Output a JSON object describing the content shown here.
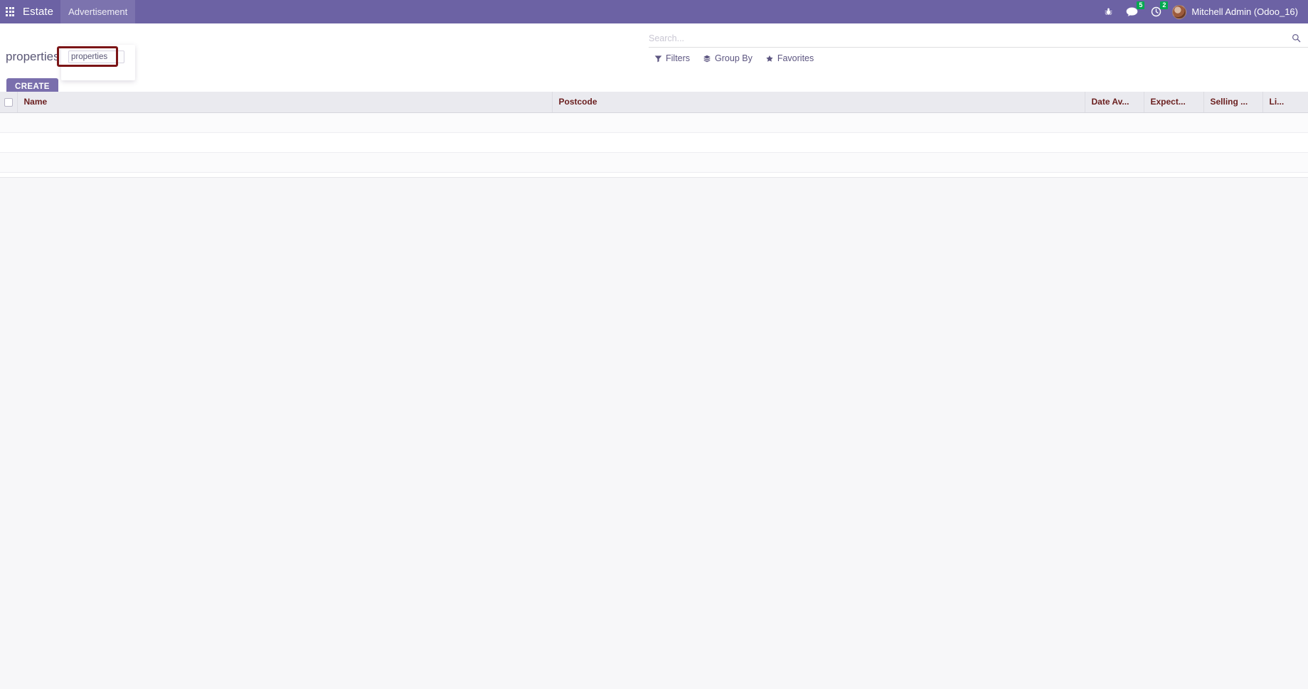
{
  "navbar": {
    "apps_icon": "apps-grid-icon",
    "brand": "Estate",
    "menus": [
      {
        "label": "Advertisement",
        "active": true
      }
    ],
    "systray": {
      "debug_icon": "bug-icon",
      "messages_icon": "chat-bubble-icon",
      "messages_count": "5",
      "activities_icon": "clock-icon",
      "activities_count": "2",
      "avatar_icon": "user-avatar",
      "user_name": "Mitchell Admin (Odoo_16)"
    }
  },
  "control_panel": {
    "breadcrumb": "properties",
    "create_label": "CREATE",
    "rename_input_value": "properties",
    "rename_input_placeholder": "properties",
    "annotation_color": "#7b1416"
  },
  "search": {
    "value": "",
    "placeholder": "Search...",
    "search_icon": "magnifier-icon",
    "facets": [
      {
        "label": "Filters",
        "icon": "funnel-icon"
      },
      {
        "label": "Group By",
        "icon": "layers-icon"
      },
      {
        "label": "Favorites",
        "icon": "star-icon"
      }
    ]
  },
  "list": {
    "select_all_icon": "checkbox-unchecked",
    "columns": [
      {
        "label": "Name"
      },
      {
        "label": "Postcode"
      },
      {
        "label": "Date Av..."
      },
      {
        "label": "Expect..."
      },
      {
        "label": "Selling ..."
      },
      {
        "label": "Li..."
      }
    ],
    "rows": [],
    "empty_row_count": 3
  },
  "colors": {
    "navbar": "#6c62a4",
    "primary": "#7a6fad",
    "header_text": "#6b2020",
    "badge": "#00a94f",
    "page_background": "#f7f7f9"
  }
}
